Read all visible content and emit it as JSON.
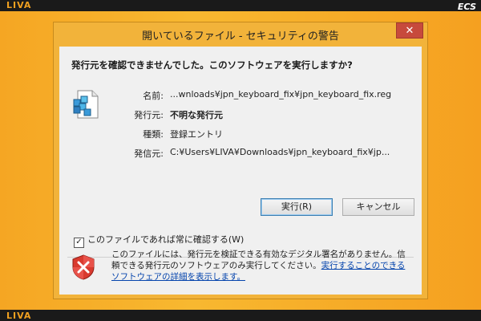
{
  "desktop": {
    "logo_top": "LIVA",
    "logo_bottom": "LIVA",
    "brand": "ECS"
  },
  "dialog": {
    "title": "開いているファイル - セキュリティの警告",
    "close_label": "✕",
    "question": "発行元を確認できませんでした。このソフトウェアを実行しますか?",
    "fields": [
      {
        "label": "名前:",
        "value": "...wnloads¥jpn_keyboard_fix¥jpn_keyboard_fix.reg",
        "bold": false
      },
      {
        "label": "発行元:",
        "value": "不明な発行元",
        "bold": true
      },
      {
        "label": "種類:",
        "value": "登録エントリ",
        "bold": false
      },
      {
        "label": "発信元:",
        "value": "C:¥Users¥LIVA¥Downloads¥jpn_keyboard_fix¥jp...",
        "bold": false
      }
    ],
    "run_button": "実行(R)",
    "cancel_button": "キャンセル",
    "checkbox_label": "このファイルであれば常に確認する(W)",
    "checkbox_checked": true,
    "warning_text": "このファイルには、発行元を検証できる有効なデジタル署名がありません。信頼できる発行元のソフトウェアのみ実行してください。",
    "warning_link": "実行することのできるソフトウェアの詳細を表示します。"
  },
  "colors": {
    "background": "#f0a020",
    "dialog_frame": "#f2b33a",
    "close_button": "#c74a3c",
    "link": "#0645ad"
  }
}
